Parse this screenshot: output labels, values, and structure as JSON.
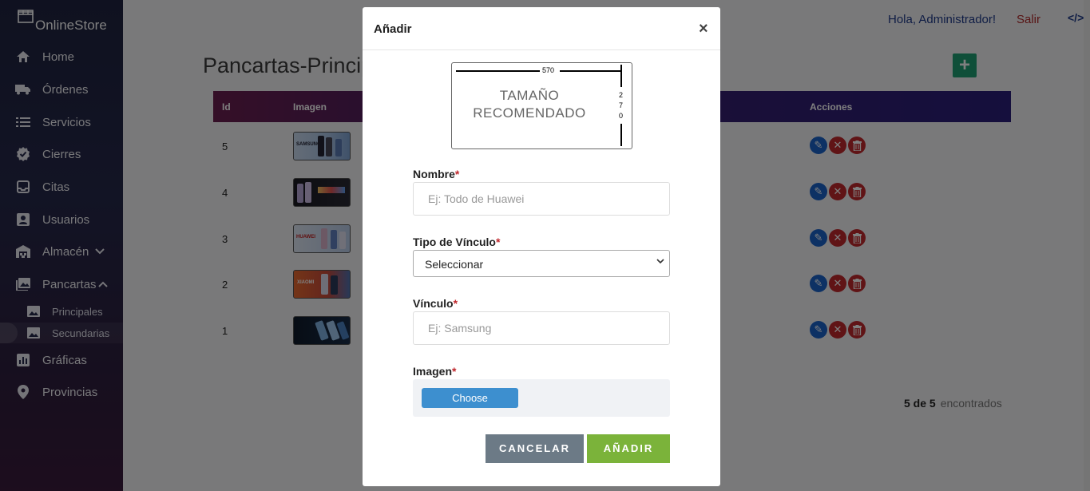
{
  "brand": {
    "name": "OnlineStore"
  },
  "sidebar": {
    "items": [
      {
        "label": "Home",
        "icon": "home-icon"
      },
      {
        "label": "Órdenes",
        "icon": "truck-icon"
      },
      {
        "label": "Servicios",
        "icon": "list-icon"
      },
      {
        "label": "Cierres",
        "icon": "badge-check-icon"
      },
      {
        "label": "Citas",
        "icon": "inbox-icon"
      },
      {
        "label": "Usuarios",
        "icon": "user-card-icon"
      },
      {
        "label": "Almacén",
        "icon": "warehouse-icon"
      },
      {
        "label": "Pancartas",
        "icon": "images-icon"
      },
      {
        "label": "Gráficas",
        "icon": "chart-icon"
      },
      {
        "label": "Provincias",
        "icon": "map-pin-icon"
      }
    ],
    "subitems": [
      {
        "label": "Principales",
        "icon": "image-icon"
      },
      {
        "label": "Secundarias",
        "icon": "image-icon"
      }
    ]
  },
  "topbar": {
    "greeting": "Hola, Administrador!",
    "logout": "Salir",
    "code_icon": "code-icon"
  },
  "page": {
    "title": "Pancartas-Princip"
  },
  "table": {
    "headers": {
      "id": "Id",
      "image": "Imagen",
      "actions": "Acciones"
    },
    "rows": [
      {
        "id": "5",
        "brand_label": "SAMSUNG"
      },
      {
        "id": "4",
        "brand_label": ""
      },
      {
        "id": "3",
        "brand_label": "HUAWEI"
      },
      {
        "id": "2",
        "brand_label": "XIAOMI"
      },
      {
        "id": "1",
        "brand_label": ""
      }
    ]
  },
  "pagination": {
    "count": "5 de 5",
    "suffix": "encontrados"
  },
  "modal": {
    "title": "Añadir",
    "close": "×",
    "recommended": {
      "width": "570",
      "height_digits": [
        "2",
        "7",
        "0"
      ],
      "line1": "TAMAÑO",
      "line2": "RECOMENDADO"
    },
    "fields": {
      "name_label": "Nombre",
      "name_placeholder": "Ej: Todo de Huawei",
      "type_label": "Tipo de Vínculo",
      "type_value": "Seleccionar",
      "link_label": "Vínculo",
      "link_placeholder": "Ej: Samsung",
      "image_label": "Imagen",
      "choose": "Choose"
    },
    "required_mark": "*",
    "buttons": {
      "cancel": "CANCELAR",
      "add": "AÑADIR"
    }
  },
  "colors": {
    "accent_green": "#1e9e72",
    "add_button": "#7bb33a",
    "cancel_button": "#6c7a86",
    "danger": "#c0282d",
    "link": "#1f3a8a"
  }
}
